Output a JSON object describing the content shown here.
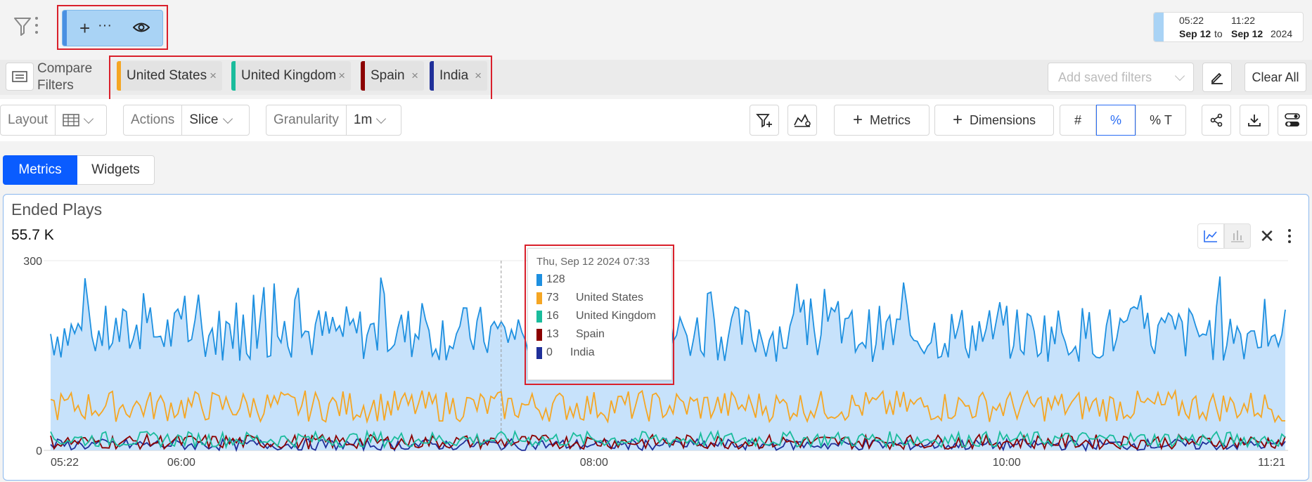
{
  "header": {
    "date_range": {
      "start_time": "05:22",
      "start_date": "Sep 12",
      "to": "to",
      "end_time": "11:22",
      "end_date": "Sep 12",
      "year": "2024"
    }
  },
  "compare": {
    "label_line1": "Compare",
    "label_line2": "Filters",
    "chips": [
      {
        "label": "United States",
        "color": "#f5a623"
      },
      {
        "label": "United Kingdom",
        "color": "#1abc9c"
      },
      {
        "label": "Spain",
        "color": "#8b0000"
      },
      {
        "label": "India",
        "color": "#1f2f99"
      }
    ],
    "saved_filters_placeholder": "Add saved filters",
    "clear_all": "Clear All"
  },
  "toolbar": {
    "layout_label": "Layout",
    "actions_label": "Actions",
    "actions_value": "Slice",
    "granularity_label": "Granularity",
    "granularity_value": "1m",
    "metrics_button": "Metrics",
    "dimensions_button": "Dimensions",
    "hash_toggle": "#",
    "percent_toggle": "%",
    "percent_t_toggle": "% T"
  },
  "tabs": [
    {
      "label": "Metrics",
      "active": true
    },
    {
      "label": "Widgets",
      "active": false
    }
  ],
  "card": {
    "title": "Ended Plays",
    "total": "55.7 K"
  },
  "chart_data": {
    "type": "area",
    "title": "Ended Plays",
    "ylim": [
      0,
      300
    ],
    "y_ticks": [
      "300",
      "0"
    ],
    "x_ticks": [
      "05:22",
      "06:00",
      "08:00",
      "10:00",
      "11:21"
    ],
    "x_range": [
      "05:22",
      "11:21"
    ],
    "series": [
      {
        "name": "",
        "color": "#1e90e0",
        "fill": "#c7e2fb",
        "typical_range": [
          140,
          230
        ],
        "peak": 275
      },
      {
        "name": "United States",
        "color": "#f5a623",
        "typical_range": [
          45,
          95
        ]
      },
      {
        "name": "United Kingdom",
        "color": "#1abc9c",
        "typical_range": [
          5,
          30
        ]
      },
      {
        "name": "Spain",
        "color": "#8b0000",
        "typical_range": [
          2,
          25
        ]
      },
      {
        "name": "India",
        "color": "#1f2f99",
        "typical_range": [
          0,
          18
        ]
      }
    ],
    "tooltip": {
      "timestamp": "Thu, Sep 12 2024 07:33",
      "rows": [
        {
          "value": "128",
          "label": "",
          "color": "#1e90e0"
        },
        {
          "value": "73",
          "label": "United States",
          "color": "#f5a623"
        },
        {
          "value": "16",
          "label": "United Kingdom",
          "color": "#1abc9c"
        },
        {
          "value": "13",
          "label": "Spain",
          "color": "#8b0000"
        },
        {
          "value": "0",
          "label": "India",
          "color": "#1f2f99"
        }
      ]
    },
    "grid": true,
    "legend": "none"
  }
}
